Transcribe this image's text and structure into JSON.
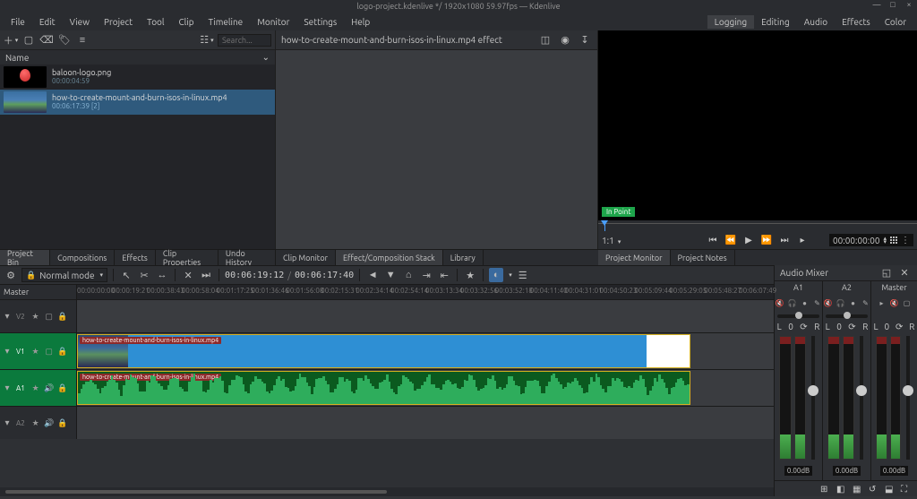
{
  "window": {
    "title": "logo-project.kdenlive */ 1920x1080 59.97fps — Kdenlive",
    "controls": {
      "min": "—",
      "max": "□",
      "close": "×"
    }
  },
  "menus": [
    "File",
    "Edit",
    "View",
    "Project",
    "Tool",
    "Clip",
    "Timeline",
    "Monitor",
    "Settings",
    "Help"
  ],
  "workspace_tabs": [
    "Logging",
    "Editing",
    "Audio",
    "Effects",
    "Color"
  ],
  "workspace_active": "Logging",
  "bin": {
    "header": "Name",
    "search_placeholder": "Search...",
    "items": [
      {
        "name": "baloon-logo.png",
        "duration": "00:00:04:59"
      },
      {
        "name": "how-to-create-mount-and-burn-isos-in-linux.mp4",
        "duration": "00:06:17:39 [2]"
      }
    ]
  },
  "bottom_tabs_left": [
    "Project Bin",
    "Compositions",
    "Effects",
    "Clip Properties",
    "Undo History"
  ],
  "effect_panel": {
    "title": "how-to-create-mount-and-burn-isos-in-linux.mp4 effect"
  },
  "bottom_tabs_mid": [
    "Clip Monitor",
    "Effect/Composition Stack",
    "Library"
  ],
  "monitor": {
    "in_point": "In Point",
    "zoom": "1:1",
    "timecode": "00:00:00:00"
  },
  "bottom_tabs_right": [
    "Project Monitor",
    "Project Notes"
  ],
  "timeline": {
    "mode": "Normal mode",
    "master": "Master",
    "position": "00:06:19:12",
    "duration": "00:06:17:40",
    "ticks": [
      "00:00:00:00",
      "00:00:19:21",
      "00:00:38:43",
      "00:00:58:04",
      "00:01:17:25",
      "00:01:36:46",
      "00:01:56:08",
      "00:02:15:31",
      "00:02:34:14",
      "00:02:54:14",
      "00:03:13:34",
      "00:03:32:56",
      "00:03:52:18",
      "00:04:11:40",
      "00:04:31:01",
      "00:04:50:23",
      "00:05:09:44",
      "00:05:29:05",
      "00:05:48:27",
      "00:06:07:49"
    ],
    "tracks": {
      "v2": "V2",
      "v1": "V1",
      "a1": "A1",
      "a2": "A2"
    },
    "clip_label": "how-to-create-mount-and-burn-isos-in-linux.mp4"
  },
  "mixer": {
    "title": "Audio Mixer",
    "channels": [
      {
        "name": "A1",
        "db": "0.00dB"
      },
      {
        "name": "A2",
        "db": "0.00dB"
      },
      {
        "name": "Master",
        "db": "0.00dB"
      }
    ],
    "lr": {
      "l": "L",
      "c": "0",
      "r": "R"
    }
  }
}
